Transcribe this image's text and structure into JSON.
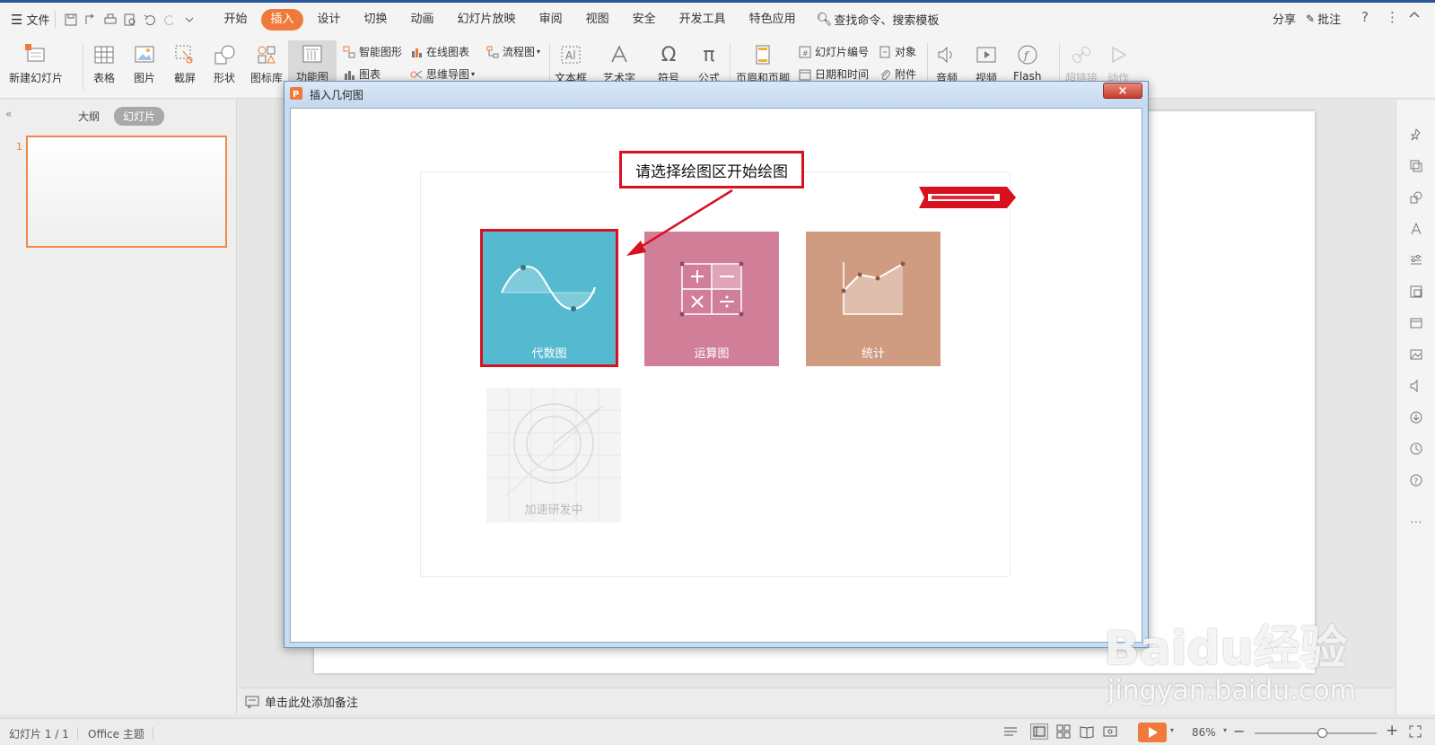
{
  "menu": {
    "file": "文件",
    "tabs": [
      "开始",
      "插入",
      "设计",
      "切换",
      "动画",
      "幻灯片放映",
      "审阅",
      "视图",
      "安全",
      "开发工具",
      "特色应用"
    ],
    "active_tab": "插入",
    "search": "查找命令、搜索模板",
    "share": "分享",
    "comment": "批注"
  },
  "ribbon": {
    "new_slide": "新建幻灯片",
    "table": "表格",
    "picture": "图片",
    "screenshot": "截屏",
    "shape": "形状",
    "icon_lib": "图标库",
    "func_chart": "功能图",
    "smart_graphic": "智能图形",
    "online_chart": "在线图表",
    "flowchart": "流程图",
    "chart": "图表",
    "mindmap": "思维导图",
    "textbox": "文本框",
    "wordart": "艺术字",
    "symbol": "符号",
    "formula": "公式",
    "header_footer": "页眉和页脚",
    "slide_number": "幻灯片编号",
    "object": "对象",
    "date_time": "日期和时间",
    "attachment": "附件",
    "audio": "音频",
    "video": "视频",
    "flash": "Flash",
    "hyperlink": "超链接",
    "action": "动作"
  },
  "left_panel": {
    "outline_tab": "大纲",
    "slides_tab": "幻灯片",
    "slide_number": "1"
  },
  "dialog": {
    "title": "插入几何图",
    "close": "×",
    "callout": "请选择绘图区开始绘图",
    "tiles": {
      "algebra": "代数图",
      "calc": "运算图",
      "stats": "统计",
      "dev": "加速研发中"
    }
  },
  "notes": {
    "placeholder": "单击此处添加备注"
  },
  "status": {
    "slide_info": "幻灯片 1 / 1",
    "theme": "Office 主题",
    "zoom": "86%",
    "zoom_level": 0.55
  },
  "watermark": {
    "brand": "Baidu经验",
    "url": "jingyan.baidu.com"
  },
  "colors": {
    "accent": "#f07a3b",
    "algebra_tile": "#55bacf",
    "calc_tile": "#d17f99",
    "stats_tile": "#cf9c82",
    "highlight": "#d9111e"
  }
}
